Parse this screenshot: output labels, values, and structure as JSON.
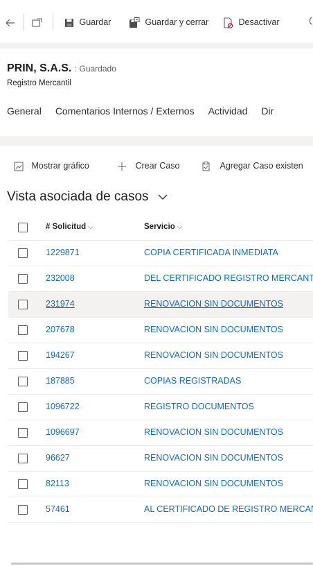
{
  "toolbar": {
    "save": "Guardar",
    "save_close": "Guardar y cerrar",
    "deactivate": "Desactivar"
  },
  "record": {
    "name": "PRIN, S.A.S.",
    "status": ": Guardado",
    "form": "Registro Mercantil"
  },
  "tabs": [
    "General",
    "Comentarios Internos / Externos",
    "Actividad",
    "Dir"
  ],
  "commands": {
    "show_chart": "Mostrar gráfico",
    "create_case": "Crear Caso",
    "add_existing": "Agregar Caso existen"
  },
  "view": {
    "title": "Vista asociada de casos"
  },
  "columns": {
    "solicitud": "# Solicitud",
    "servicio": "Servicio"
  },
  "rows": [
    {
      "solicitud": "1229871",
      "servicio": "COPIA CERTIFICADA INMEDIATA"
    },
    {
      "solicitud": "232008",
      "servicio": "DEL CERTIFICADO REGISTRO MERCANT"
    },
    {
      "solicitud": "231974",
      "servicio": "RENOVACION SIN DOCUMENTOS"
    },
    {
      "solicitud": "207678",
      "servicio": "RENOVACION SIN DOCUMENTOS"
    },
    {
      "solicitud": "194267",
      "servicio": "RENOVACION SIN DOCUMENTOS"
    },
    {
      "solicitud": "187885",
      "servicio": "COPIAS REGISTRADAS"
    },
    {
      "solicitud": "1096722",
      "servicio": "REGISTRO DOCUMENTOS"
    },
    {
      "solicitud": "1096697",
      "servicio": "RENOVACION SIN DOCUMENTOS"
    },
    {
      "solicitud": "96627",
      "servicio": "RENOVACION SIN DOCUMENTOS"
    },
    {
      "solicitud": "82113",
      "servicio": "RENOVACION SIN DOCUMENTOS"
    },
    {
      "solicitud": "57461",
      "servicio": "AL CERTIFICADO DE REGISTRO MERCAN"
    }
  ],
  "colors": {
    "link": "#0f6cbd",
    "text": "#323130",
    "hover_row": "#f3f2f1"
  }
}
